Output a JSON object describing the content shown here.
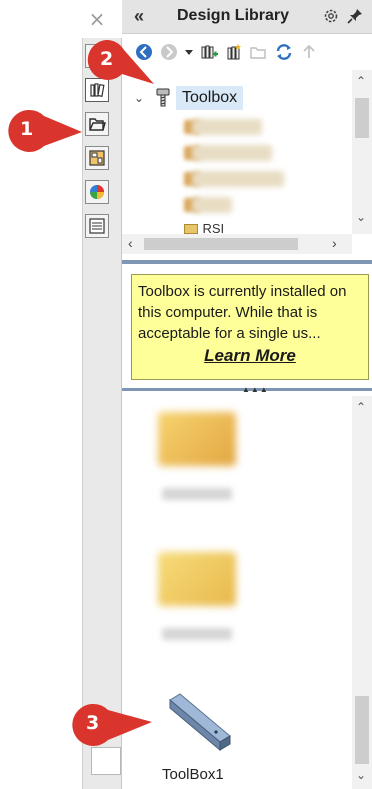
{
  "header": {
    "collapse_glyph": "«",
    "title": "Design Library",
    "icons": [
      "settings-icon",
      "pin-icon"
    ]
  },
  "close_glyph": "×",
  "tabs": [
    "home-tab",
    "design-library-tab",
    "file-explorer-tab",
    "view-palette-tab",
    "appearances-tab",
    "custom-properties-tab"
  ],
  "toolbar": {
    "items": [
      "back-icon",
      "forward-icon",
      "dropdown-icon",
      "add-to-library-icon",
      "add-file-location-icon",
      "create-folder-icon",
      "refresh-icon",
      "up-icon"
    ]
  },
  "tree": {
    "root_label": "Toolbox",
    "partial_label": "RSI"
  },
  "info_box": {
    "text": "Toolbox is currently installed on this computer. While that is acceptable for a single us...",
    "link": "Learn More"
  },
  "lower_panel": {
    "item_label": "ToolBox1"
  },
  "callouts": [
    "1",
    "2",
    "3"
  ],
  "colors": {
    "callout_red": "#d9352c",
    "info_yellow": "#ffff99",
    "selection_blue": "#d9e9f8",
    "splitter": "#7e96b4"
  }
}
